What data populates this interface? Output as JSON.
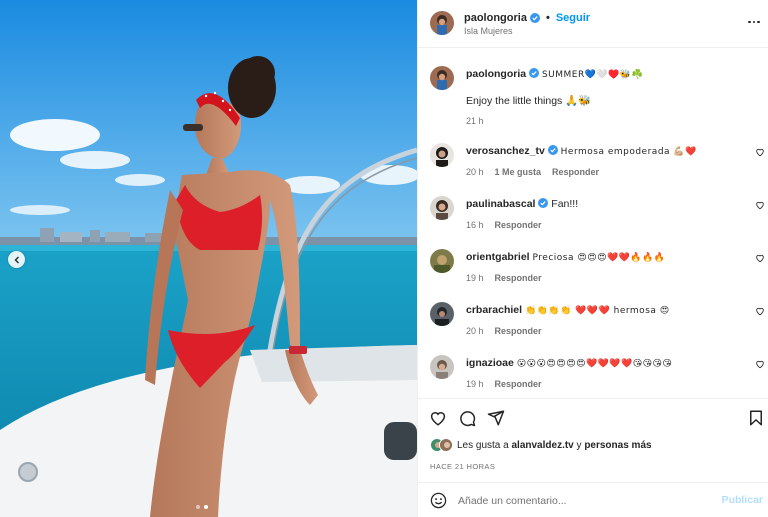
{
  "post": {
    "username": "paolongoria",
    "follow_label": "Seguir",
    "separator": "•",
    "location": "Isla Mujeres",
    "caption_title": "SUMMER💙🤍♥️🐝☘️",
    "caption_line2": "Enjoy the little things 🙏🐝",
    "caption_time": "21 h"
  },
  "comments": [
    {
      "username": "verosanchez_tv",
      "verified": true,
      "text": "Hermosa empoderada 💪🏼❤️",
      "time": "20 h",
      "likes": "1 Me gusta",
      "reply": "Responder"
    },
    {
      "username": "paulinabascal",
      "verified": true,
      "text": "Fan!!!",
      "time": "16 h",
      "likes": "",
      "reply": "Responder"
    },
    {
      "username": "orientgabriel",
      "verified": false,
      "text": "Preciosa 😍😍😍❤️❤️🔥🔥🔥",
      "time": "19 h",
      "likes": "",
      "reply": "Responder"
    },
    {
      "username": "crbarachiel",
      "verified": false,
      "text": "👏👏👏👏 ❤️❤️❤️ hermosa 😍",
      "time": "20 h",
      "likes": "",
      "reply": "Responder"
    },
    {
      "username": "ignazioae",
      "verified": false,
      "text": "😮😮😮😍😍😍😍❤️❤️❤️❤️😘😘😘😘",
      "time": "19 h",
      "likes": "",
      "reply": "Responder"
    }
  ],
  "likes": {
    "prefix": "Les gusta a ",
    "user": "alanvaldez.tv",
    "middle": " y ",
    "others": "personas más"
  },
  "timestamp": "HACE 21 HORAS",
  "comment_box": {
    "placeholder": "Añade un comentario...",
    "publish_label": "Publicar"
  },
  "colors": {
    "accent": "#0095f6",
    "publish_disabled": "#b2dffc",
    "verified": "#3897f0",
    "like_red": "#ed4956"
  },
  "icons": [
    "heart-icon",
    "comment-icon",
    "share-icon",
    "bookmark-icon",
    "emoji-icon",
    "more-icon",
    "chevron-left-icon",
    "verified-icon"
  ]
}
